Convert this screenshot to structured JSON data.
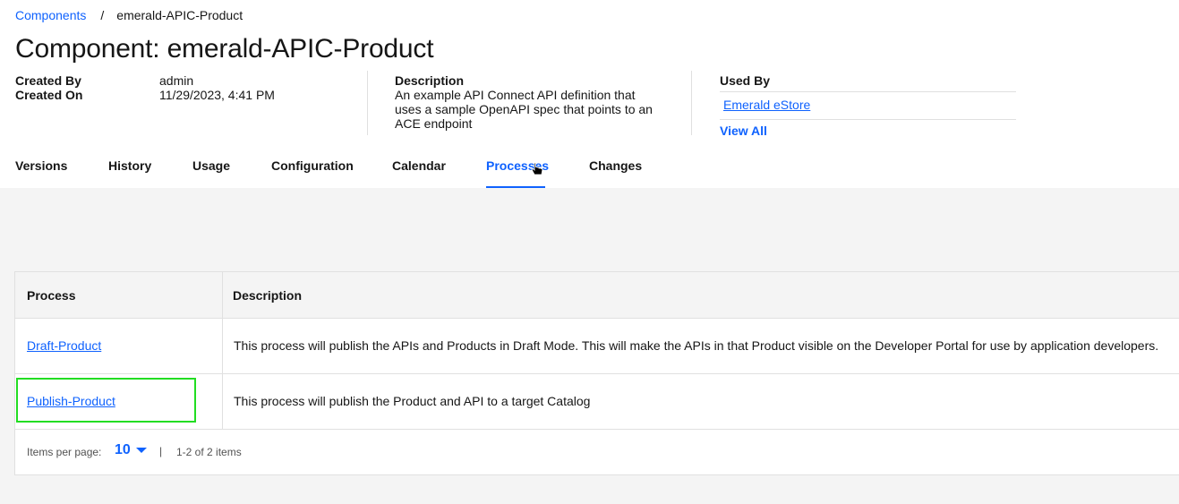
{
  "breadcrumb": {
    "root": "Components",
    "separator": "/",
    "current": "emerald-APIC-Product"
  },
  "page_title": "Component: emerald-APIC-Product",
  "meta": {
    "created_by_label": "Created By",
    "created_on_label": "Created On",
    "created_by_value": "admin",
    "created_on_value": "11/29/2023, 4:41 PM"
  },
  "description": {
    "label": "Description",
    "line1": "An example API Connect API definition that",
    "line2": "uses a sample OpenAPI spec that points to an",
    "line3": "ACE endpoint"
  },
  "used_by": {
    "label": "Used By",
    "items": [
      "Emerald eStore"
    ],
    "view_all": "View All"
  },
  "tabs": [
    {
      "label": "Versions"
    },
    {
      "label": "History"
    },
    {
      "label": "Usage"
    },
    {
      "label": "Configuration"
    },
    {
      "label": "Calendar"
    },
    {
      "label": "Processes",
      "active": true
    },
    {
      "label": "Changes"
    }
  ],
  "table": {
    "headers": [
      "Process",
      "Description"
    ],
    "rows": [
      {
        "process": "Draft-Product",
        "description": "This process will publish the APIs and Products in Draft Mode. This will make the APIs in that Product visible on the Developer Portal for use by application developers."
      },
      {
        "process": "Publish-Product",
        "description": "This process will publish the Product and API to a target Catalog"
      }
    ]
  },
  "pagination": {
    "items_per_page_label": "Items per page:",
    "items_per_page": "10",
    "separator": "|",
    "range": "1-2 of 2 items"
  },
  "colors": {
    "accent": "#0f62fe",
    "highlight": "#22dd22",
    "background": "#f4f4f4"
  }
}
